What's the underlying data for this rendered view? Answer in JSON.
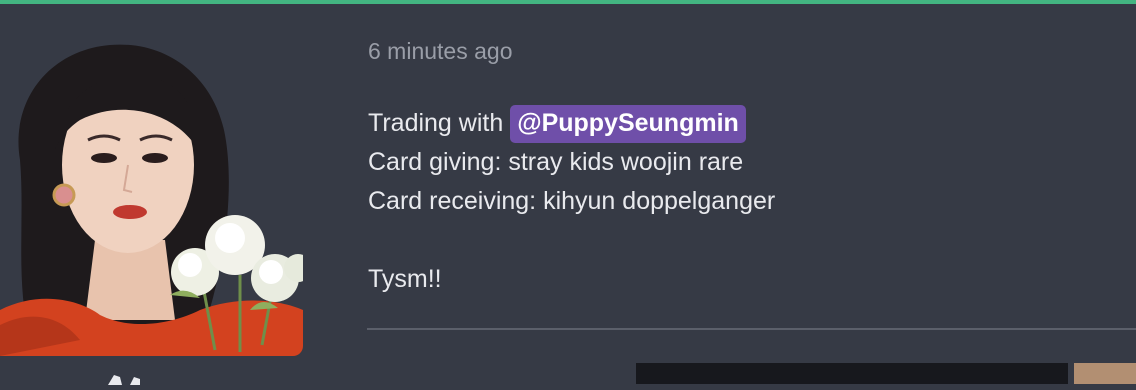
{
  "post": {
    "timestamp": "6 minutes ago",
    "message": {
      "prefix": "Trading with ",
      "mention": "@PuppySeungmin",
      "line2": "Card giving: stray kids woojin rare",
      "line3": "Card receiving: kihyun doppelganger",
      "line5": "Tysm!!"
    }
  },
  "colors": {
    "accent_bar": "#43b581",
    "mention_bg": "#6f4fa9",
    "background": "#363a45"
  },
  "icons": {
    "avatar": "avatar-image"
  }
}
